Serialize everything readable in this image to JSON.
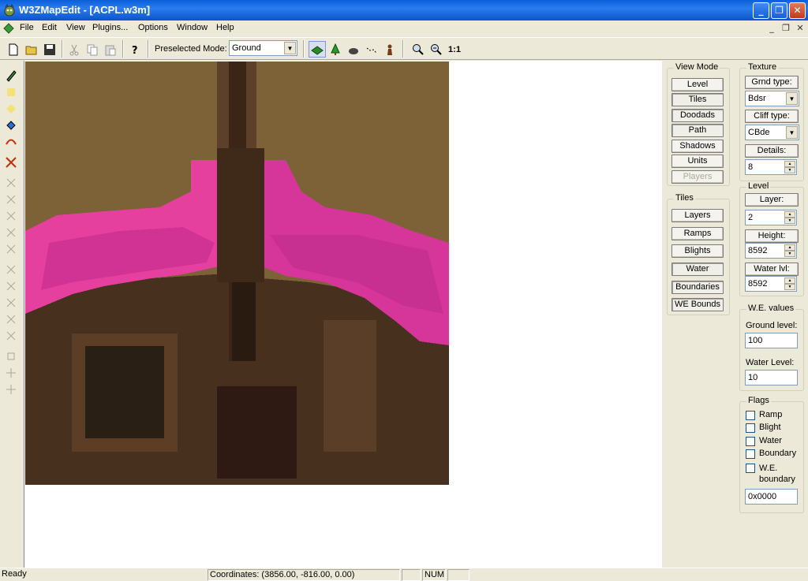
{
  "window": {
    "title": "W3ZMapEdit - [ACPL.w3m]"
  },
  "menu": {
    "items": [
      "File",
      "Edit",
      "View",
      "Plugins...",
      "Options",
      "Window",
      "Help"
    ]
  },
  "toolbar": {
    "preselected_label": "Preselected Mode:",
    "preselected_value": "Ground",
    "zoom_reset_label": "1:1"
  },
  "view_mode": {
    "title": "View Mode",
    "buttons": [
      "Level",
      "Tiles",
      "Doodads",
      "Path",
      "Shadows",
      "Units",
      "Players"
    ]
  },
  "tiles": {
    "title": "Tiles",
    "buttons": [
      "Layers",
      "Ramps",
      "Blights",
      "Water",
      "Boundaries",
      "WE Bounds"
    ]
  },
  "texture": {
    "title": "Texture",
    "grnd_type_label": "Grnd type:",
    "grnd_type_value": "Bdsr",
    "cliff_type_label": "Cliff type:",
    "cliff_type_value": "CBde",
    "details_label": "Details:",
    "details_value": "8"
  },
  "level": {
    "title": "Level",
    "layer_label": "Layer:",
    "layer_value": "2",
    "height_label": "Height:",
    "height_value": "8592",
    "water_lvl_label": "Water lvl:",
    "water_lvl_value": "8592"
  },
  "we_values": {
    "title": "W.E. values",
    "ground_level_label": "Ground level:",
    "ground_level_value": "100",
    "water_level_label": "Water Level:",
    "water_level_value": "10"
  },
  "flags": {
    "title": "Flags",
    "items": [
      "Ramp",
      "Blight",
      "Water",
      "Boundary",
      "W.E. boundary"
    ],
    "hex_value": "0x0000"
  },
  "status": {
    "ready": "Ready",
    "coordinates": "Coordinates: (3856.00, -816.00, 0.00)",
    "num": "NUM"
  },
  "colors": {
    "titlebar": "#0a5fd8",
    "map_ground": "#7d6238",
    "map_dark_ground": "#47301d",
    "map_blight": "#e6409f",
    "map_road": "#5a3d26"
  }
}
